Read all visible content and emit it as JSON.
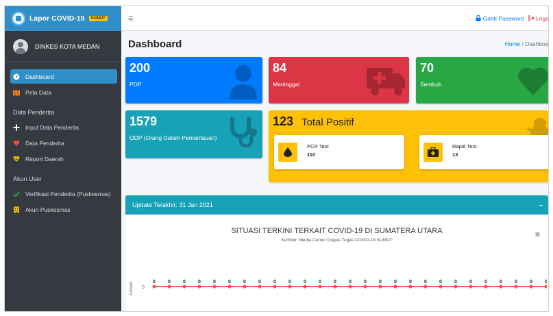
{
  "brand": {
    "title": "Lapor COVID-19",
    "badge": "SUMUT"
  },
  "user": {
    "name": "DINKES KOTA MEDAN"
  },
  "sidebar": {
    "items": [
      {
        "label": "Dashboard",
        "icon": "dashboard-icon",
        "active": true
      },
      {
        "label": "Peta Data",
        "icon": "map-icon"
      }
    ],
    "sections": [
      {
        "header": "Data Penderita",
        "items": [
          {
            "label": "Input Data Penderita",
            "icon": "plus-icon"
          },
          {
            "label": "Data Penderita",
            "icon": "heart-icon"
          },
          {
            "label": "Report Daerah",
            "icon": "heartbeat-icon"
          }
        ]
      },
      {
        "header": "Akun User",
        "items": [
          {
            "label": "Verifikasi Penderita (Puskesmas)",
            "icon": "check-icon"
          },
          {
            "label": "Akun Puskesmas",
            "icon": "building-icon"
          }
        ]
      }
    ]
  },
  "topbar": {
    "change_password": "Ganti Password",
    "logout": "Logout"
  },
  "page": {
    "title": "Dashboard",
    "breadcrumb_home": "Home",
    "breadcrumb_sep": "/",
    "breadcrumb_current": "Dashboard"
  },
  "stats": {
    "pdp": {
      "value": "200",
      "label": "PDP",
      "color": "#007bff"
    },
    "meninggal": {
      "value": "84",
      "label": "Meninggal",
      "color": "#dc3545"
    },
    "sembuh": {
      "value": "70",
      "label": "Sembuh",
      "color": "#28a745"
    },
    "odp": {
      "value": "1579",
      "label": "ODP (Orang Dalam Pemantauan)",
      "color": "#17a2b8"
    },
    "positif": {
      "value": "123",
      "label": "Total Positif",
      "color": "#ffc107",
      "pcr": {
        "title": "PCR Test",
        "value": "110"
      },
      "rapid": {
        "title": "Rapid Test",
        "value": "13"
      }
    }
  },
  "chart_panel": {
    "header": "Update Terakhir: 31 Jan 2021",
    "collapse": "–",
    "title": "SITUASI TERKINI TERKAIT COVID-19 DI SUMATERA UTARA",
    "subtitle": "Sumber: Media Center Gugus Tugas COVID-19 SUMUT"
  },
  "chart_data": {
    "type": "line",
    "title": "SITUASI TERKINI TERKAIT COVID-19 DI SUMATERA UTARA",
    "subtitle": "Sumber: Media Center Gugus Tugas COVID-19 SUMUT",
    "ylabel": "Jumlah",
    "y_ticks": [
      "0"
    ],
    "series": [
      {
        "color": "#f45b5b",
        "values": [
          0,
          0,
          0,
          0,
          0,
          0,
          0,
          0,
          0,
          0,
          0,
          0,
          0,
          0,
          0,
          0,
          0,
          0,
          0,
          0,
          0,
          0,
          0,
          0,
          0,
          0,
          0,
          0,
          0
        ]
      }
    ]
  }
}
